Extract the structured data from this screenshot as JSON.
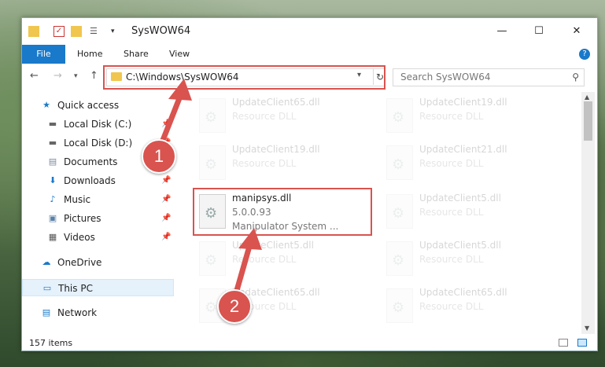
{
  "window": {
    "title": "SysWOW64"
  },
  "ribbon": {
    "file": "File",
    "tabs": [
      "Home",
      "Share",
      "View"
    ],
    "help": "?"
  },
  "nav": {
    "address": "C:\\Windows\\SysWOW64",
    "search_placeholder": "Search SysWOW64"
  },
  "sidebar": {
    "items": [
      {
        "label": "Quick access",
        "icon": "star-icon"
      },
      {
        "label": "Local Disk (C:)",
        "icon": "drive-icon"
      },
      {
        "label": "Local Disk (D:)",
        "icon": "drive-icon"
      },
      {
        "label": "Documents",
        "icon": "documents-icon"
      },
      {
        "label": "Downloads",
        "icon": "download-icon"
      },
      {
        "label": "Music",
        "icon": "music-icon"
      },
      {
        "label": "Pictures",
        "icon": "pictures-icon"
      },
      {
        "label": "Videos",
        "icon": "videos-icon"
      },
      {
        "label": "OneDrive",
        "icon": "cloud-icon"
      },
      {
        "label": "This PC",
        "icon": "pc-icon"
      },
      {
        "label": "Network",
        "icon": "network-icon"
      }
    ]
  },
  "files": {
    "left": [
      {
        "name": "UpdateClient65.dll",
        "desc": "Resource DLL"
      },
      {
        "name": "UpdateClient19.dll",
        "desc": "Resource DLL"
      },
      {
        "name": "manipsys.dll",
        "version": "5.0.0.93",
        "desc": "Manipulator System ..."
      },
      {
        "name": "UpdateClient5.dll",
        "desc": "Resource DLL"
      },
      {
        "name": "UpdateClient65.dll",
        "desc": "Resource DLL"
      }
    ],
    "right": [
      {
        "name": "UpdateClient19.dll",
        "desc": "Resource DLL"
      },
      {
        "name": "UpdateClient21.dll",
        "desc": "Resource DLL"
      },
      {
        "name": "UpdateClient5.dll",
        "desc": "Resource DLL"
      },
      {
        "name": "UpdateClient5.dll",
        "desc": "Resource DLL"
      },
      {
        "name": "UpdateClient65.dll",
        "desc": "Resource DLL"
      }
    ]
  },
  "status": {
    "count": "157 items"
  },
  "annotations": {
    "step1": "1",
    "step2": "2"
  },
  "colors": {
    "accent": "#1979ca",
    "highlight": "#d9534f"
  }
}
